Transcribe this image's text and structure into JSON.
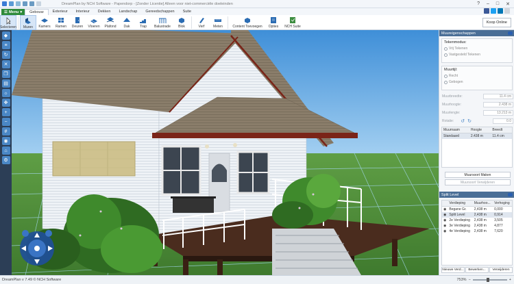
{
  "window": {
    "title": "DreamPlan by NCH Software - Papendorp - [Zonder Licentie] Alleen voor niet-commerciële doeleinden",
    "buttons": [
      "?",
      "–",
      "□",
      "✕"
    ]
  },
  "menu": {
    "label": "Menu"
  },
  "tabs": [
    "Gebouw",
    "Exterieur",
    "Interieur",
    "Dekken",
    "Landschap",
    "Gereedschappen",
    "Suite"
  ],
  "active_tab": "Gebouw",
  "toolbar": {
    "items": [
      {
        "label": "Selecteren",
        "icon": "cursor-icon"
      },
      {
        "label": "Muren",
        "icon": "wall-icon"
      },
      {
        "label": "Kamers",
        "icon": "room-icon"
      },
      {
        "label": "Ramen",
        "icon": "window-icon"
      },
      {
        "label": "Deuren",
        "icon": "door-icon"
      },
      {
        "label": "Vloeren",
        "icon": "floor-icon"
      },
      {
        "label": "Plafond",
        "icon": "ceiling-icon"
      },
      {
        "label": "Dak",
        "icon": "roof-icon"
      },
      {
        "label": "Trap",
        "icon": "stairs-icon"
      },
      {
        "label": "Balustrade",
        "icon": "railing-icon"
      },
      {
        "label": "Blok",
        "icon": "block-icon"
      },
      {
        "label": "Verf",
        "icon": "paint-icon"
      },
      {
        "label": "Meten",
        "icon": "ruler-icon"
      },
      {
        "label": "Content Toevoegen",
        "icon": "add-content-icon"
      },
      {
        "label": "Opties",
        "icon": "options-icon"
      },
      {
        "label": "NCH Suite",
        "icon": "nch-suite-icon"
      }
    ],
    "buy_label": "Koop Online"
  },
  "wall_panel": {
    "title": "Muureigenschappen",
    "draw_mode_label": "Tekenmodus:",
    "draw_modes": [
      "Vrij Tekenen",
      "Vastgesteld Tekenen"
    ],
    "wall_type_label": "Muurtijl:",
    "wall_types": [
      "Recht",
      "Gebogen"
    ],
    "fields": [
      {
        "label": "Muurbreedte:",
        "value": "11.4 cm"
      },
      {
        "label": "Muurhoogte:",
        "value": "2.438 m"
      },
      {
        "label": "Muurlengte:",
        "value": "13.213 m"
      },
      {
        "label": "Rotatie:",
        "value": "0.0"
      }
    ],
    "table": {
      "headers": [
        "Muurnaam",
        "Hoogte",
        "Breedt"
      ],
      "rows": [
        [
          "Standaard",
          "2.438 m",
          "11.4 cm"
        ]
      ]
    },
    "buttons": [
      "Muursoort Maken",
      "Muursoort Verwijderen"
    ]
  },
  "split_panel": {
    "title": "Split Level",
    "table": {
      "headers": [
        "Verdieping",
        "Muurhoo...",
        "Verhoging"
      ],
      "rows": [
        [
          "Begane Gr.",
          "2,438 m",
          "0,000"
        ],
        [
          "Split Level",
          "2,438 m",
          "0,914"
        ],
        [
          "2e Verdieping",
          "2,438 m",
          "3,505"
        ],
        [
          "3e Verdieping",
          "2,438 m",
          "4,877"
        ],
        [
          "4e Verdieping",
          "2,438 m",
          "7,620"
        ]
      ]
    },
    "buttons": [
      "Nieuwe Verd...",
      "Bewerken...",
      "Verwijderen"
    ]
  },
  "status": {
    "text": "DreamPlan v 7.49 © NCH Software",
    "zoom": "753%"
  },
  "colors": {
    "accent": "#2e8b3a",
    "panel_header": "#4a6e96",
    "sky": "#6fb3e6",
    "grass": "#4f8f3a",
    "roof": "#8a7a66",
    "siding": "#eef2f6",
    "deck": "#4a2c1e"
  }
}
